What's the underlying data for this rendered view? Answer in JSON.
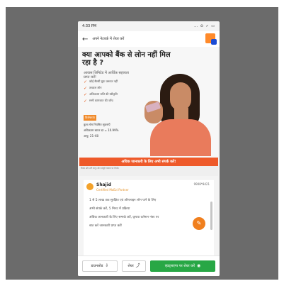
{
  "status_bar": {
    "time": "4:33 PM",
    "icons": "… ⊙ ✓ ▭"
  },
  "app_bar": {
    "title": "अपने नेटवर्क में शेयर करें",
    "back_icon": "back-arrow-icon",
    "logo_icon": "brand-logo-icon"
  },
  "banner": {
    "headline": "क्या आपको बैंक से लोन नहीं मिल रहा है ?",
    "subtext": "आवास लिमिटेड में आर्थिक सहायता प्राप्त करें!",
    "bullets": [
      "कोई सैलरी प्रूफ जरूरत नहीं",
      "तत्काल लोन",
      "अधिकतम राशि की स्वीकृति",
      "सभी कागजात की जाँच"
    ],
    "offer_header": "विशेषताएं",
    "offer_lines": [
      "कुल लोन नियमित सूचनाएँ",
      "अधिकतम ब्याज दर = 10.99%",
      "आयु: 21–60"
    ],
    "cta": "अधिक जानकारी के लिए अभी संपर्क करें!",
    "fine_print": "नियम और शर्तें लागू। लोन मंजूरी पात्रता पर निर्भर।"
  },
  "agent": {
    "name": "Shajid",
    "role": "Certified MoEzi Partner",
    "phone": "9908*8421"
  },
  "message": {
    "lines": [
      "1 से 5 लाख तक सुरक्षित एवं ऑनलाइन लोन पाने के लिए",
      "अभी संपर्क करें, 5 मिनट में प्रक्रिया",
      "",
      "अधिक जानकारी के लिए सम्पर्क करें, कृपया वर्तमान नंबर पर",
      "बात करें जानकारी प्राप्त करें!"
    ]
  },
  "bottom_bar": {
    "download_label": "डाउनलोड",
    "share_label": "शेयर",
    "whatsapp_label": "व्हाट्सएप्प पर शेयर करें"
  },
  "colors": {
    "accent_orange": "#ee5a2a",
    "whatsapp_green": "#28a745",
    "fab_orange": "#f07f1e"
  }
}
